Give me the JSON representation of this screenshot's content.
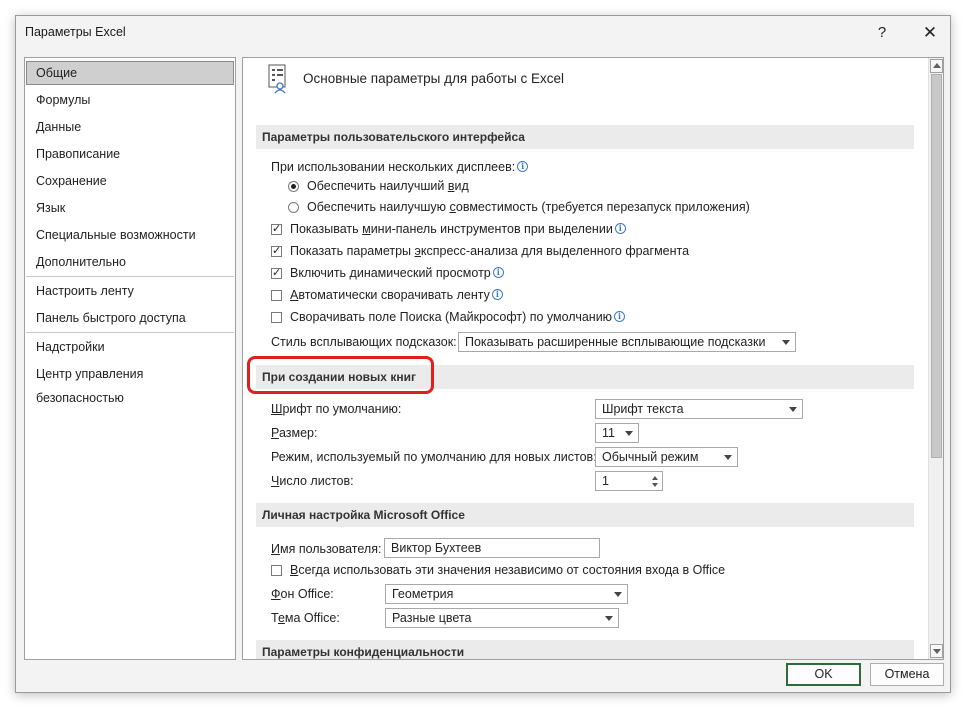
{
  "window": {
    "title": "Параметры Excel",
    "help_label": "?",
    "close_label": "✕"
  },
  "nav": {
    "items": [
      {
        "label": "Общие",
        "selected": true
      },
      {
        "label": "Формулы"
      },
      {
        "label": "Данные"
      },
      {
        "label": "Правописание"
      },
      {
        "label": "Сохранение"
      },
      {
        "label": "Язык"
      },
      {
        "label": "Специальные возможности"
      },
      {
        "label": "Дополнительно"
      },
      {
        "label": "Настроить ленту"
      },
      {
        "label": "Панель быстрого доступа"
      },
      {
        "label": "Надстройки"
      },
      {
        "label": "Центр управления безопасностью"
      }
    ]
  },
  "page": {
    "header": "Основные параметры для работы с Excel",
    "header_icon": "general-settings-icon"
  },
  "ui_section": {
    "title": "Параметры пользовательского интерфейса",
    "multi_display_label": "При использовании нескольких дисплеев:",
    "radio_best_look": "Обеспечить наилучший вид",
    "radio_best_look_checked": true,
    "radio_compat": "Обеспечить наилучшую совместимость (требуется перезапуск приложения)",
    "radio_compat_checked": false,
    "cb_minitoolbar": "Показывать мини-панель инструментов при выделении",
    "cb_minitoolbar_checked": true,
    "cb_quickanalysis": "Показать параметры экспресс-анализа для выделенного фрагмента",
    "cb_quickanalysis_checked": true,
    "cb_livepreview": "Включить динамический просмотр",
    "cb_livepreview_checked": true,
    "cb_collapse_ribbon": "Автоматически сворачивать ленту",
    "cb_collapse_ribbon_checked": false,
    "cb_collapse_search": "Сворачивать поле Поиска (Майкрософт) по умолчанию",
    "cb_collapse_search_checked": false,
    "tooltip_style_label": "Стиль всплывающих подсказок:",
    "tooltip_style_value": "Показывать расширенные всплывающие подсказки"
  },
  "new_wb_section": {
    "title": "При создании новых книг",
    "font_label": "Шрифт по умолчанию:",
    "font_value": "Шрифт текста",
    "size_label": "Размер:",
    "size_value": "11",
    "view_label": "Режим, используемый по умолчанию для новых листов:",
    "view_value": "Обычный режим",
    "sheets_label": "Число листов:",
    "sheets_value": "1"
  },
  "personal_section": {
    "title": "Личная настройка Microsoft Office",
    "username_label": "Имя пользователя:",
    "username_value": "Виктор Бухтеев",
    "cb_always_use": "Всегда использовать эти значения независимо от состояния входа в Office",
    "cb_always_use_checked": false,
    "background_label": "Фон Office:",
    "background_value": "Геометрия",
    "theme_label": "Тема Office:",
    "theme_value": "Разные цвета"
  },
  "privacy_section": {
    "title": "Параметры конфиденциальности"
  },
  "buttons": {
    "ok": "OK",
    "cancel": "Отмена"
  },
  "colors": {
    "highlight": "#e02020",
    "info_icon": "#3a7ac8",
    "ok_border": "#2e6b3a"
  }
}
